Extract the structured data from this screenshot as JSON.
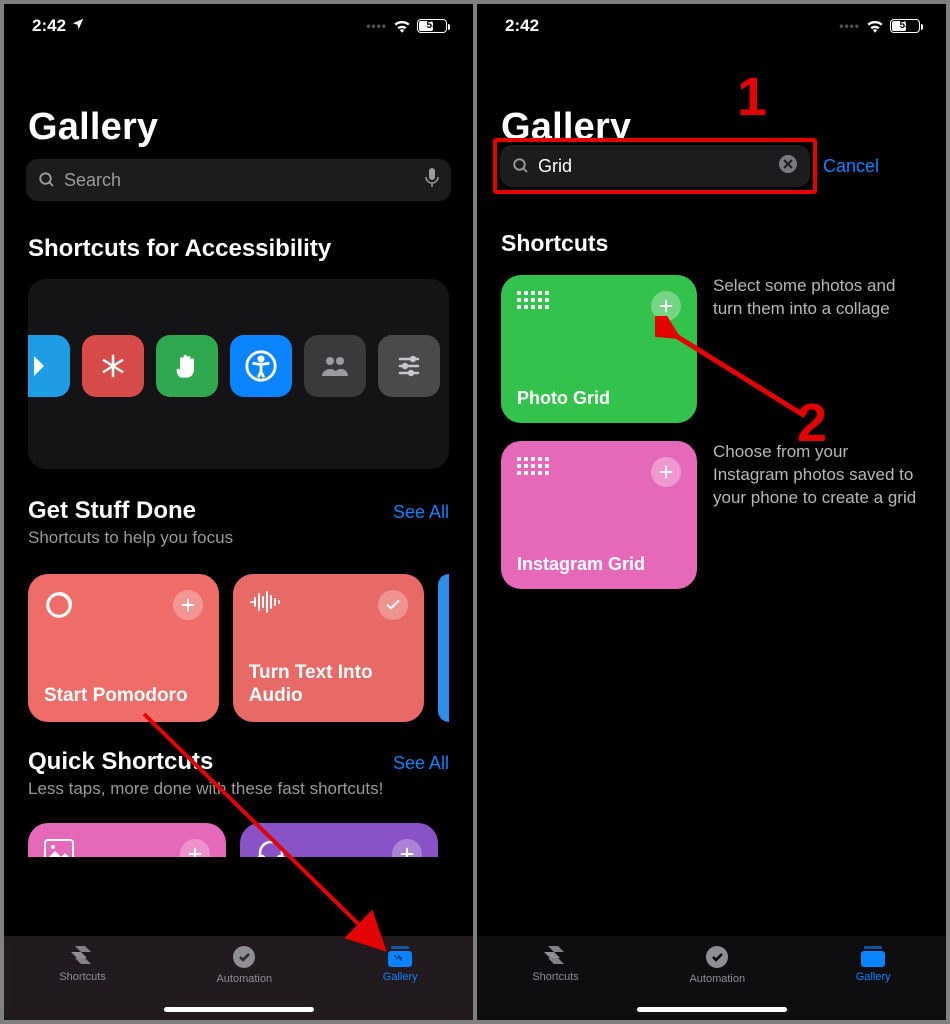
{
  "status": {
    "time": "2:42",
    "battery_pct": "53",
    "battery_fill_pct": 53
  },
  "left": {
    "title": "Gallery",
    "search_placeholder": "Search",
    "accessibility_title": "Shortcuts for Accessibility",
    "get_stuff": {
      "title": "Get Stuff Done",
      "sub": "Shortcuts to help you focus",
      "see_all": "See All"
    },
    "cards": {
      "pomodoro": "Start Pomodoro",
      "turn_text": "Turn Text Into Audio"
    },
    "quick": {
      "title": "Quick Shortcuts",
      "sub": "Less taps, more done with these fast shortcuts!",
      "see_all": "See All"
    }
  },
  "right": {
    "title": "Gallery",
    "search_value": "Grid",
    "cancel": "Cancel",
    "results_title": "Shortcuts",
    "results": [
      {
        "name": "Photo Grid",
        "desc": "Select some photos and turn them into a collage"
      },
      {
        "name": "Instagram Grid",
        "desc": "Choose from your Instagram photos saved to your phone to create a grid"
      }
    ]
  },
  "tabs": {
    "shortcuts": "Shortcuts",
    "automation": "Automation",
    "gallery": "Gallery"
  },
  "anno": {
    "one": "1",
    "two": "2"
  }
}
